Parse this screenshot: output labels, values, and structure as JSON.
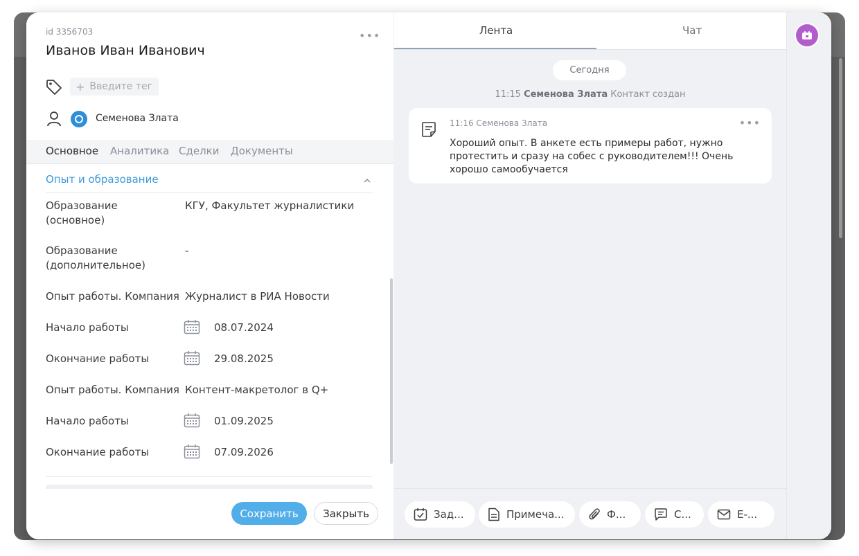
{
  "contact": {
    "id_label": "id 3356703",
    "name": "Иванов Иван Иванович",
    "tag_placeholder": "Введите тег",
    "owner": "Семенова Злата"
  },
  "left_tabs": [
    "Основное",
    "Аналитика",
    "Сделки",
    "Документы"
  ],
  "active_tab": "Основное",
  "section": {
    "title": "Опыт и образование",
    "fields": [
      {
        "label": "Образование (основное)",
        "value": "КГУ, Факультет журналистики"
      },
      {
        "label": "Образование (дополнительное)",
        "value": "-"
      },
      {
        "label": "Опыт работы. Компания",
        "value": "Журналист в РИА Новости"
      },
      {
        "label": "Начало работы",
        "value": "08.07.2024"
      },
      {
        "label": "Окончание работы",
        "value": "29.08.2025"
      },
      {
        "label": "Опыт работы. Компания",
        "value": "Контент-макретолог в Q+"
      },
      {
        "label": "Начало работы",
        "value": "01.09.2025"
      },
      {
        "label": "Окончание работы",
        "value": "07.09.2026"
      }
    ]
  },
  "footer": {
    "save": "Сохранить",
    "close": "Закрыть"
  },
  "feed": {
    "tabs": [
      "Лента",
      "Чат"
    ],
    "active_tab": "Лента",
    "date_pill": "Сегодня",
    "event": {
      "time": "11:15",
      "author": "Семенова Злата",
      "text": "Контакт создан"
    },
    "note": {
      "time": "11:16",
      "author": "Семенова Злата",
      "text": "Хороший опыт. В анкете есть примеры работ, нужно протестить и сразу на собес с руководителем!!! Очень хорошо самообучается"
    },
    "actions": [
      "Зад...",
      "Примеча...",
      "Ф...",
      "С...",
      "E-..."
    ]
  },
  "icons": [
    "tag-icon",
    "person-icon",
    "calendar-icon",
    "note-icon",
    "task-icon",
    "document-icon",
    "paperclip-icon",
    "chat-icon",
    "mail-icon",
    "app-icon",
    "more-icon",
    "chevron-up-icon"
  ],
  "colors": {
    "accent": "#52aee9",
    "link": "#3a9ad9",
    "app_badge": "#b35ccc",
    "owner_avatar": "#2e8fd8"
  }
}
